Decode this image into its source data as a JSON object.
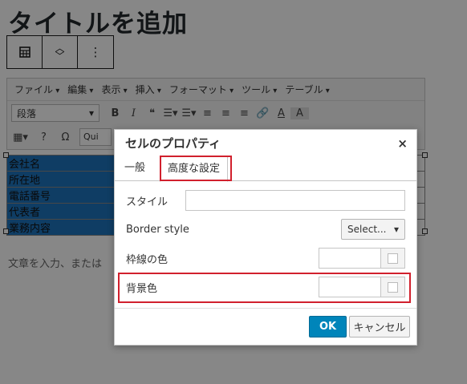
{
  "editor": {
    "post_title": "タイトルを追加",
    "block_toolbar": {
      "block_icon": "table-block-icon",
      "move_icon": "up-down-arrows-icon",
      "more_label": "⋮"
    },
    "menubar": [
      "ファイル",
      "編集",
      "表示",
      "挿入",
      "フォーマット",
      "ツール",
      "テーブル"
    ],
    "toolbar": {
      "format_select": "段落",
      "bold": "B",
      "italic": "I",
      "blockquote": "❝",
      "font_color_label": "A",
      "bg_color_label": "A",
      "small_input": "Qui"
    },
    "table_rows": [
      "会社名",
      "所在地",
      "電話番号",
      "代表者",
      "業務内容"
    ],
    "placeholder": "文章を入力、または"
  },
  "dialog": {
    "title": "セルのプロパティ",
    "close_icon": "×",
    "tabs": [
      {
        "label": "一般"
      },
      {
        "label": "高度な設定"
      }
    ],
    "fields": {
      "style_label": "スタイル",
      "style_value": "",
      "border_style_label": "Border style",
      "border_style_value": "Select...",
      "border_color_label": "枠線の色",
      "border_color_value": "",
      "bg_color_label": "背景色",
      "bg_color_value": ""
    },
    "buttons": {
      "ok": "OK",
      "cancel": "キャンセル"
    }
  },
  "colors": {
    "primary_button": "#0085ba",
    "highlight": "#d1202d",
    "selected_cell": "#1e73be",
    "overlay": "rgba(0,0,0,0.47)"
  }
}
